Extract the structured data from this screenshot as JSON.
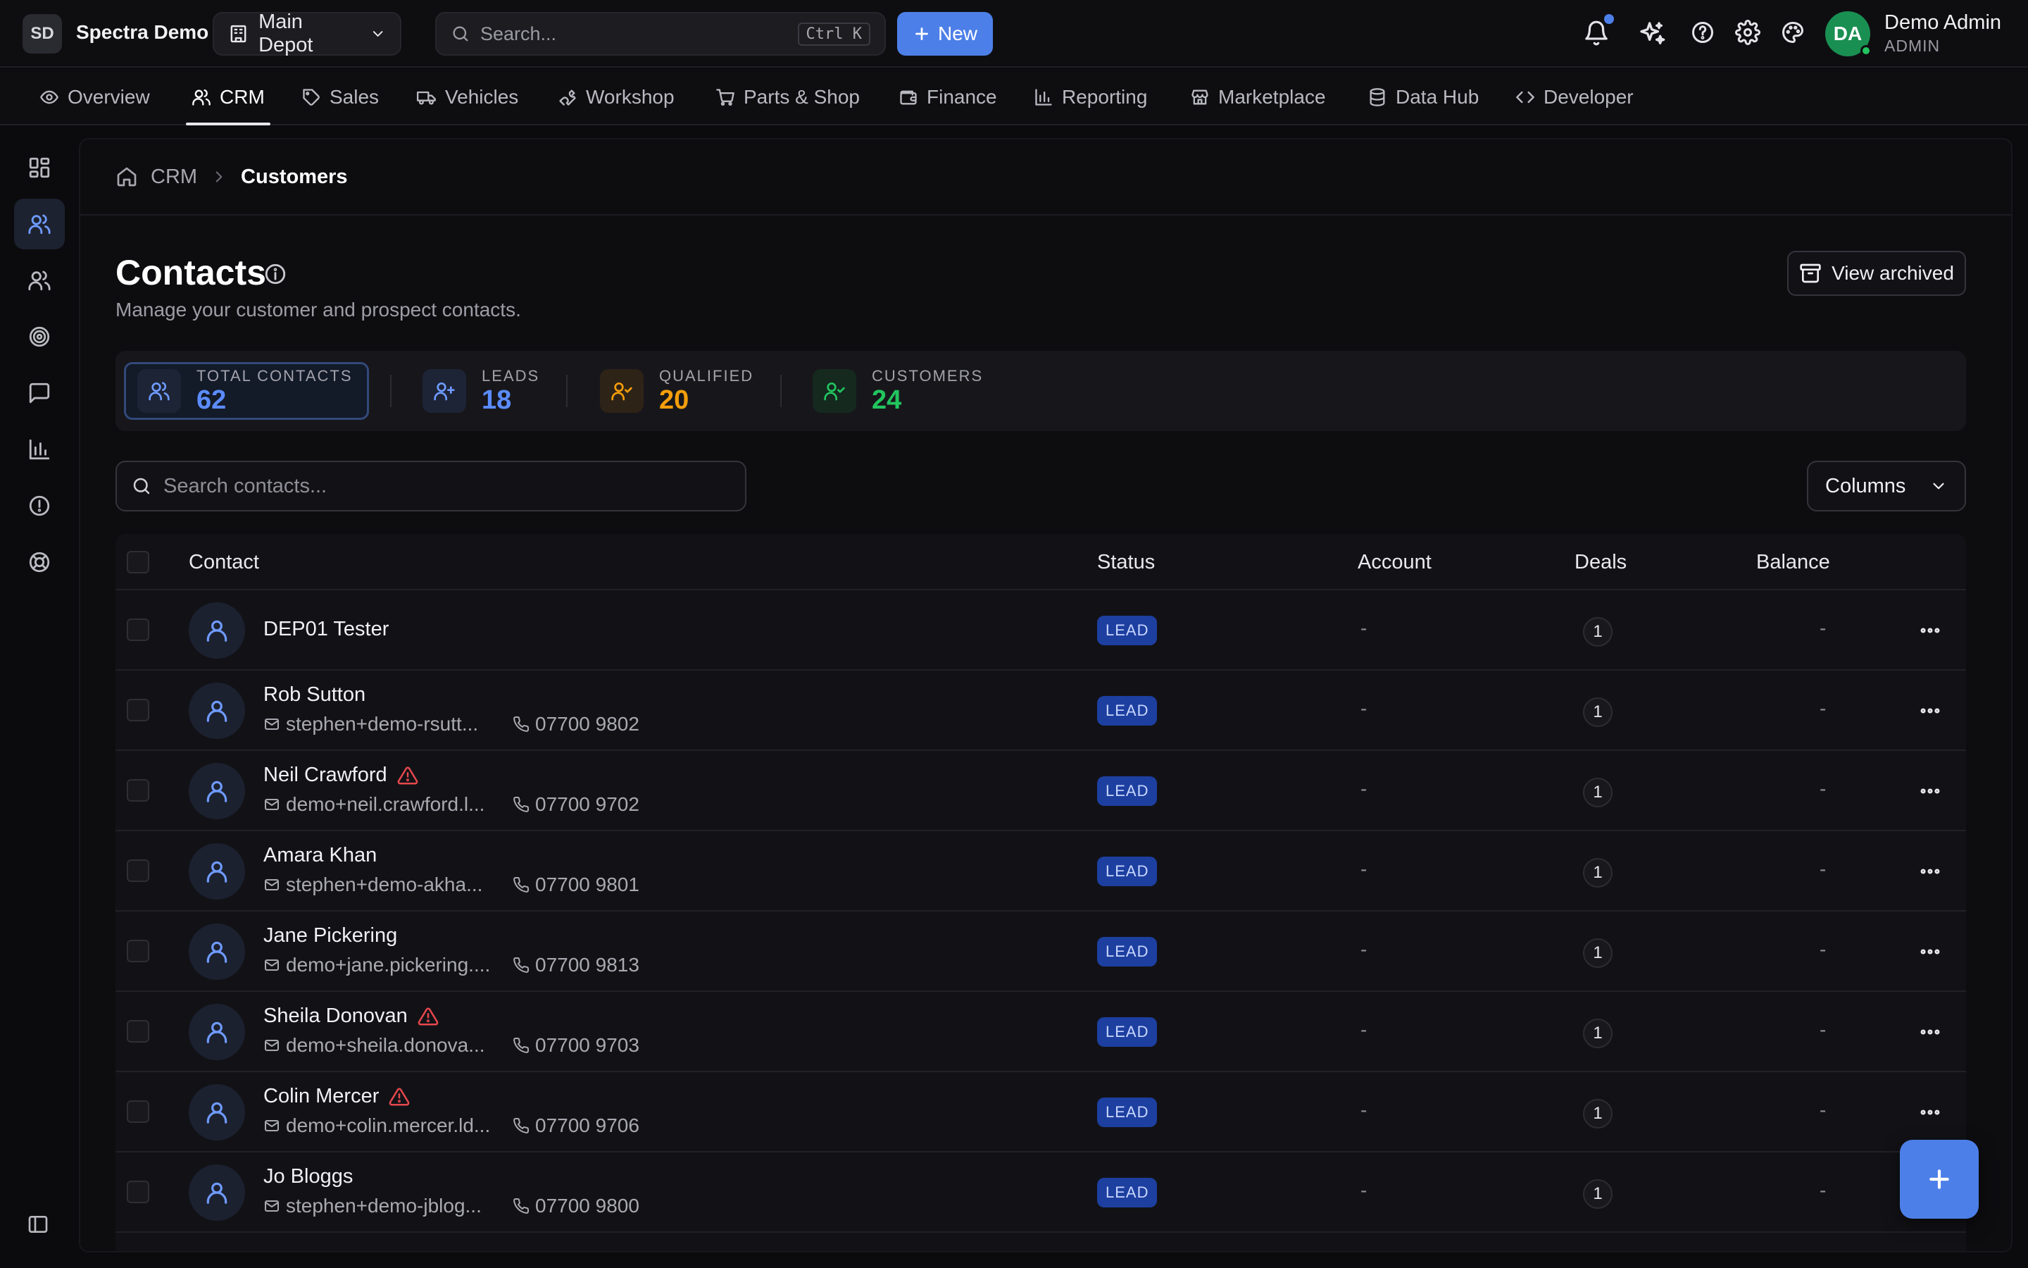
{
  "header": {
    "org_initials": "SD",
    "org_name": "Spectra Demo",
    "depot": "Main Depot",
    "search_placeholder": "Search...",
    "search_shortcut": "Ctrl K",
    "new_label": "New",
    "user_initials": "DA",
    "user_name": "Demo Admin",
    "user_role": "ADMIN"
  },
  "nav": {
    "tabs": [
      {
        "label": "Overview",
        "icon": "eye-icon"
      },
      {
        "label": "CRM",
        "icon": "users-icon",
        "active": true
      },
      {
        "label": "Sales",
        "icon": "tag-icon"
      },
      {
        "label": "Vehicles",
        "icon": "truck-icon"
      },
      {
        "label": "Workshop",
        "icon": "wrench-icon"
      },
      {
        "label": "Parts & Shop",
        "icon": "cart-icon"
      },
      {
        "label": "Finance",
        "icon": "wallet-icon"
      },
      {
        "label": "Reporting",
        "icon": "bar-chart-icon"
      },
      {
        "label": "Marketplace",
        "icon": "store-icon"
      },
      {
        "label": "Data Hub",
        "icon": "database-icon"
      },
      {
        "label": "Developer",
        "icon": "code-icon"
      }
    ]
  },
  "breadcrumb": {
    "root": "CRM",
    "current": "Customers"
  },
  "page": {
    "title": "Contacts",
    "subtitle": "Manage your customer and prospect contacts.",
    "archived_label": "View archived"
  },
  "stats": [
    {
      "label": "TOTAL CONTACTS",
      "value": "62",
      "color": "#5b8cff"
    },
    {
      "label": "LEADS",
      "value": "18",
      "color": "#5b8cff"
    },
    {
      "label": "QUALIFIED",
      "value": "20",
      "color": "#f59e0b"
    },
    {
      "label": "CUSTOMERS",
      "value": "24",
      "color": "#22c55e"
    }
  ],
  "toolbar": {
    "search_placeholder": "Search contacts...",
    "columns_label": "Columns"
  },
  "table": {
    "columns": {
      "contact": "Contact",
      "status": "Status",
      "account": "Account",
      "deals": "Deals",
      "balance": "Balance"
    },
    "rows": [
      {
        "name": "DEP01 Tester",
        "email": "",
        "phone": "",
        "warning": false,
        "status": "LEAD",
        "account": "-",
        "deals": "1",
        "balance": "-"
      },
      {
        "name": "Rob Sutton",
        "email": "stephen+demo-rsutt...",
        "phone": "07700 9802",
        "warning": false,
        "status": "LEAD",
        "account": "-",
        "deals": "1",
        "balance": "-"
      },
      {
        "name": "Neil Crawford",
        "email": "demo+neil.crawford.l...",
        "phone": "07700 9702",
        "warning": true,
        "status": "LEAD",
        "account": "-",
        "deals": "1",
        "balance": "-"
      },
      {
        "name": "Amara Khan",
        "email": "stephen+demo-akha...",
        "phone": "07700 9801",
        "warning": false,
        "status": "LEAD",
        "account": "-",
        "deals": "1",
        "balance": "-"
      },
      {
        "name": "Jane Pickering",
        "email": "demo+jane.pickering....",
        "phone": "07700 9813",
        "warning": false,
        "status": "LEAD",
        "account": "-",
        "deals": "1",
        "balance": "-"
      },
      {
        "name": "Sheila Donovan",
        "email": "demo+sheila.donova...",
        "phone": "07700 9703",
        "warning": true,
        "status": "LEAD",
        "account": "-",
        "deals": "1",
        "balance": "-"
      },
      {
        "name": "Colin Mercer",
        "email": "demo+colin.mercer.ld...",
        "phone": "07700 9706",
        "warning": true,
        "status": "LEAD",
        "account": "-",
        "deals": "1",
        "balance": "-"
      },
      {
        "name": "Jo Bloggs",
        "email": "stephen+demo-jblog...",
        "phone": "07700 9800",
        "warning": false,
        "status": "LEAD",
        "account": "-",
        "deals": "1",
        "balance": "-"
      }
    ]
  },
  "colors": {
    "accent": "#4d7fe8",
    "lead_badge": "#1d3fa0",
    "warning": "#e5484d",
    "online": "#22c55e"
  }
}
